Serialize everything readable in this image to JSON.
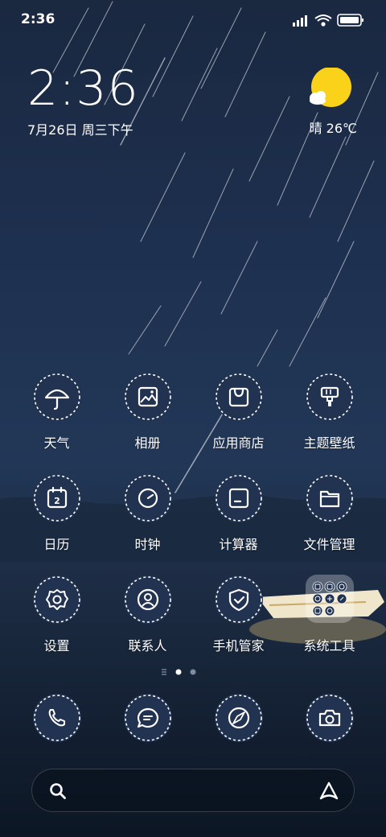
{
  "status_bar": {
    "time": "2:36"
  },
  "clock_widget": {
    "time": "2:36",
    "date": "7月26日 周三下午"
  },
  "weather_widget": {
    "condition": "晴",
    "temperature": "26℃",
    "text": "晴 26℃"
  },
  "apps": [
    {
      "label": "天气",
      "icon": "umbrella-icon"
    },
    {
      "label": "相册",
      "icon": "image-icon"
    },
    {
      "label": "应用商店",
      "icon": "shopping-bag-icon"
    },
    {
      "label": "主题壁纸",
      "icon": "paintbrush-icon"
    },
    {
      "label": "日历",
      "icon": "calendar-icon",
      "icon_text": "2"
    },
    {
      "label": "时钟",
      "icon": "clock-icon"
    },
    {
      "label": "计算器",
      "icon": "calculator-icon"
    },
    {
      "label": "文件管理",
      "icon": "folder-icon"
    },
    {
      "label": "设置",
      "icon": "gear-icon"
    },
    {
      "label": "联系人",
      "icon": "person-icon"
    },
    {
      "label": "手机管家",
      "icon": "shield-check-icon"
    },
    {
      "label": "系统工具",
      "icon": "folder-grid-icon"
    }
  ],
  "dock": [
    {
      "name": "phone",
      "icon": "phone-icon"
    },
    {
      "name": "messages",
      "icon": "chat-icon"
    },
    {
      "name": "browser",
      "icon": "compass-icon"
    },
    {
      "name": "camera",
      "icon": "camera-icon"
    }
  ],
  "page_indicator": {
    "pages": 2,
    "current": 1
  },
  "colors": {
    "sun": "#fbd21a",
    "icon_bg": "#223351",
    "wallpaper_top": "#1a2840"
  }
}
